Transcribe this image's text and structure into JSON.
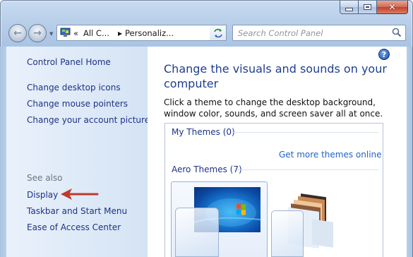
{
  "window": {
    "caption_buttons": {
      "minimize": "minimize",
      "maximize": "maximize",
      "close": "✕"
    }
  },
  "nav": {
    "address_parts": [
      "«",
      "All C...",
      "Personaliz..."
    ],
    "search_placeholder": "Search Control Panel"
  },
  "sidebar": {
    "home": "Control Panel Home",
    "links": [
      "Change desktop icons",
      "Change mouse pointers",
      "Change your account picture"
    ],
    "see_also_label": "See also",
    "see_also_links": [
      "Display",
      "Taskbar and Start Menu",
      "Ease of Access Center"
    ]
  },
  "main": {
    "help": "?",
    "title": "Change the visuals and sounds on your computer",
    "description": "Click a theme to change the desktop background, window color, sounds, and screen saver all at once.",
    "my_themes": "My Themes (0)",
    "get_more": "Get more themes online",
    "aero_themes": "Aero Themes (7)"
  },
  "colors": {
    "link": "#1e3287",
    "title": "#1e3e8f",
    "annotation_arrow": "#c0392b"
  }
}
